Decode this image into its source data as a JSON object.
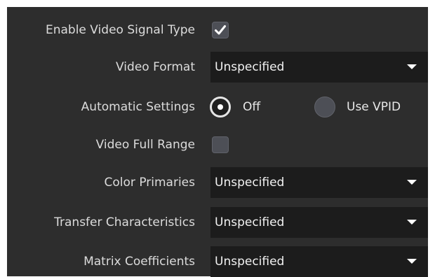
{
  "fields": {
    "enable_video_signal_type": {
      "label": "Enable Video Signal Type",
      "checked": true
    },
    "video_format": {
      "label": "Video Format",
      "value": "Unspecified"
    },
    "automatic_settings": {
      "label": "Automatic Settings",
      "options": [
        {
          "label": "Off",
          "selected": true
        },
        {
          "label": "Use VPID",
          "selected": false
        }
      ]
    },
    "video_full_range": {
      "label": "Video Full Range",
      "checked": false
    },
    "color_primaries": {
      "label": "Color Primaries",
      "value": "Unspecified"
    },
    "transfer_characteristics": {
      "label": "Transfer Characteristics",
      "value": "Unspecified"
    },
    "matrix_coefficients": {
      "label": "Matrix Coefficients",
      "value": "Unspecified"
    }
  },
  "icons": {
    "check": "checkmark-icon",
    "dropdown_arrow": "caret-down-icon"
  },
  "colors": {
    "panel_background": "#2d2d2d",
    "dropdown_background": "#1c1c1c",
    "control_background": "#4d4f56",
    "label_text": "#dcdcdc",
    "value_text": "#f2f2f2"
  }
}
